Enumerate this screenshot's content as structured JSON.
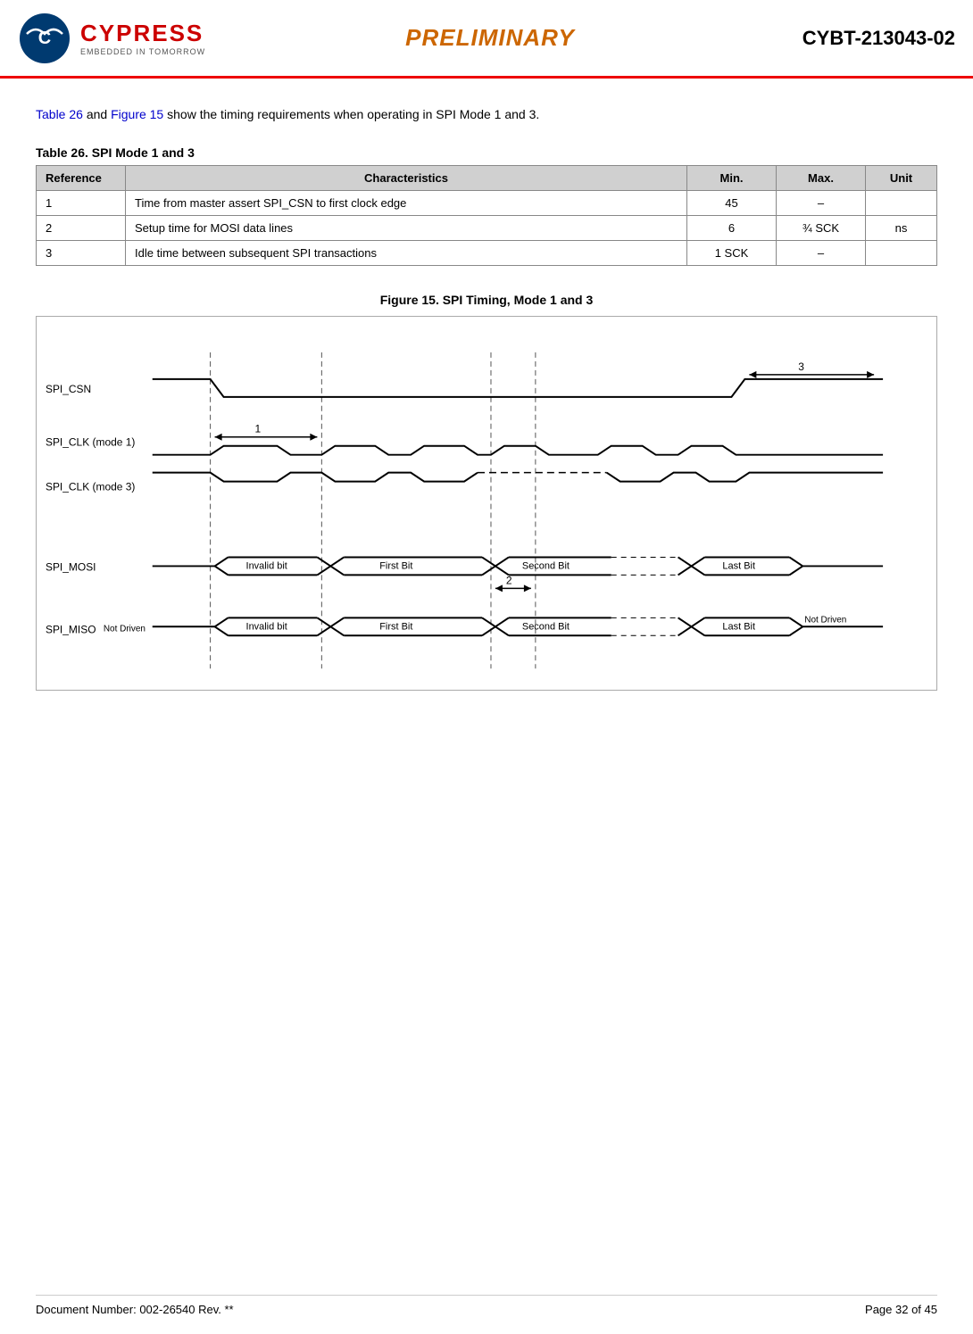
{
  "header": {
    "logo_brand": "CYPRESS",
    "logo_sub": "EMBEDDED IN TOMORROW",
    "title": "PRELIMINARY",
    "doc_number": "CYBT-213043-02"
  },
  "intro": {
    "text_before_table": "Table 26",
    "text_middle": " and ",
    "text_figure_ref": "Figure 15",
    "text_after": " show the timing requirements when operating in SPI Mode 1 and 3."
  },
  "table": {
    "title": "Table 26.  SPI Mode 1 and 3",
    "columns": [
      "Reference",
      "Characteristics",
      "Min.",
      "Max.",
      "Unit"
    ],
    "rows": [
      {
        "ref": "1",
        "char": "Time from master assert SPI_CSN to first clock edge",
        "min": "45",
        "max": "–",
        "unit": ""
      },
      {
        "ref": "2",
        "char": "Setup time for MOSI data lines",
        "min": "6",
        "max": "¾ SCK",
        "unit": "ns"
      },
      {
        "ref": "3",
        "char": "Idle time between subsequent SPI transactions",
        "min": "1 SCK",
        "max": "–",
        "unit": ""
      }
    ]
  },
  "figure": {
    "title": "Figure 15.  SPI Timing, Mode 1 and 3",
    "signals": [
      {
        "name": "SPI_CSN"
      },
      {
        "name": "SPI_CLK (mode 1)"
      },
      {
        "name": "SPI_CLK (mode 3)"
      },
      {
        "name": "SPI_MOSI"
      },
      {
        "name": "SPI_MISO"
      }
    ],
    "labels": {
      "annotation1": "1",
      "annotation2": "2",
      "annotation3": "3",
      "invalid_bit": "Invalid bit",
      "first_bit": "First Bit",
      "second_bit": "Second Bit",
      "last_bit": "Last Bit",
      "not_driven_left": "Not Driven",
      "not_driven_right": "Not Driven"
    }
  },
  "footer": {
    "doc_number": "Document Number: 002-26540 Rev. **",
    "page": "Page 32 of 45"
  }
}
